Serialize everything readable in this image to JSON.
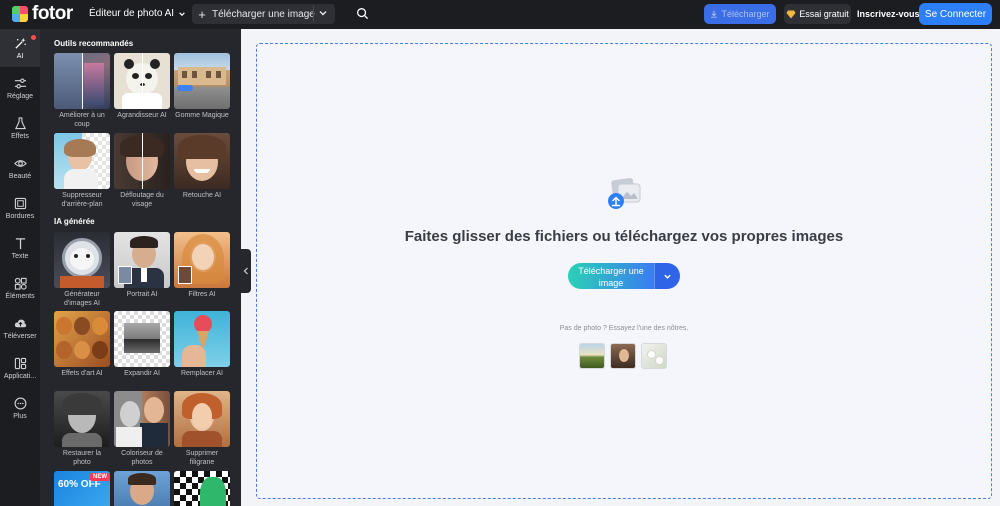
{
  "app": {
    "logo_text": "fotor",
    "editor_menu": "Éditeur de photo AI"
  },
  "header": {
    "upload_button": "Télécharger une image",
    "download_button": "Télécharger",
    "trial_button": "Essai gratuit",
    "signup_link": "Inscrivez-vous",
    "login_button": "Se Connecter"
  },
  "rail": {
    "items": [
      {
        "label": "AI",
        "icon": "magic-wand-icon"
      },
      {
        "label": "Réglage",
        "icon": "sliders-icon"
      },
      {
        "label": "Effets",
        "icon": "flask-icon"
      },
      {
        "label": "Beauté",
        "icon": "eye-icon"
      },
      {
        "label": "Bordures",
        "icon": "frame-icon"
      },
      {
        "label": "Texte",
        "icon": "text-icon"
      },
      {
        "label": "Éléments",
        "icon": "shapes-icon"
      },
      {
        "label": "Téléverser",
        "icon": "cloud-upload-icon"
      },
      {
        "label": "Applicati...",
        "icon": "apps-icon"
      },
      {
        "label": "Plus",
        "icon": "more-icon"
      }
    ]
  },
  "panel": {
    "section1_title": "Outils recommandés",
    "section2_title": "IA générée",
    "recommended": [
      {
        "label": "Améliorer à un coup"
      },
      {
        "label": "Agrandisseur AI"
      },
      {
        "label": "Gomme Magique"
      },
      {
        "label": "Suppresseur d'arrière-plan"
      },
      {
        "label": "Défloutage du visage"
      },
      {
        "label": "Retouche AI"
      }
    ],
    "generated": [
      {
        "label": "Générateur d'images AI"
      },
      {
        "label": "Portrait AI"
      },
      {
        "label": "Filtres AI"
      },
      {
        "label": "Effets d'art AI"
      },
      {
        "label": "Expandir AI"
      },
      {
        "label": "Remplacer AI"
      },
      {
        "label": "Restaurer la photo"
      },
      {
        "label": "Coloriseur de photos"
      },
      {
        "label": "Supprimer filigrane"
      }
    ],
    "promo_badge": "60% OFF",
    "new_badge": "NEW"
  },
  "main": {
    "headline": "Faites glisser des fichiers ou téléchargez vos propres images",
    "upload_button": "Télécharger une image",
    "sample_text": "Pas de photo ? Essayez l'une des nôtres."
  },
  "colors": {
    "accent": "#2d7ff9",
    "dark": "#1c1d21",
    "panel": "#26272c"
  }
}
